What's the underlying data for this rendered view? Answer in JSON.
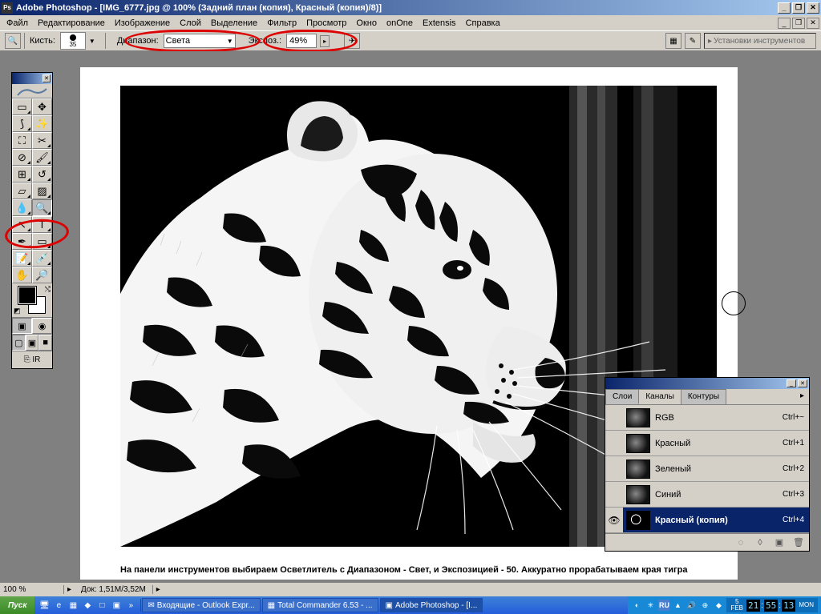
{
  "title": "Adobe Photoshop - [IMG_6777.jpg @ 100% (Задний план (копия), Красный (копия)/8)]",
  "menu": {
    "file": "Файл",
    "edit": "Редактирование",
    "image": "Изображение",
    "layer": "Слой",
    "select": "Выделение",
    "filter": "Фильтр",
    "view": "Просмотр",
    "window": "Окно",
    "onone": "onOne",
    "extensis": "Extensis",
    "help": "Справка"
  },
  "options": {
    "brush_label": "Кисть:",
    "brush_size": "35",
    "range_label": "Диапазон:",
    "range_value": "Света",
    "exposure_label": "Экспоз.:",
    "exposure_value": "49%",
    "palette_well": "Установки инструментов"
  },
  "channels": {
    "tab_layers": "Слои",
    "tab_channels": "Каналы",
    "tab_paths": "Контуры",
    "rows": [
      {
        "name": "RGB",
        "key": "Ctrl+~",
        "eye": false
      },
      {
        "name": "Красный",
        "key": "Ctrl+1",
        "eye": false
      },
      {
        "name": "Зеленый",
        "key": "Ctrl+2",
        "eye": false
      },
      {
        "name": "Синий",
        "key": "Ctrl+3",
        "eye": false
      },
      {
        "name": "Красный (копия)",
        "key": "Ctrl+4",
        "eye": true,
        "selected": true
      }
    ]
  },
  "caption": "На панели инструментов выбираем Осветлитель с Диапазоном - Свет, и Экспозицией - 50. Аккуратно прорабатываем края тигра",
  "status": {
    "zoom": "100 %",
    "doc": "Док: 1,51M/3,52M"
  },
  "taskbar": {
    "start": "Пуск",
    "tasks": [
      {
        "label": "Входящие - Outlook Expr..."
      },
      {
        "label": "Total Commander 6.53 - ..."
      },
      {
        "label": "Adobe Photoshop - [I...",
        "active": true
      }
    ],
    "lang": "RU",
    "time": {
      "h": "21",
      "m": "55",
      "s": "13",
      "date_d": "5",
      "date_m": "FEB",
      "day": "MON"
    }
  }
}
